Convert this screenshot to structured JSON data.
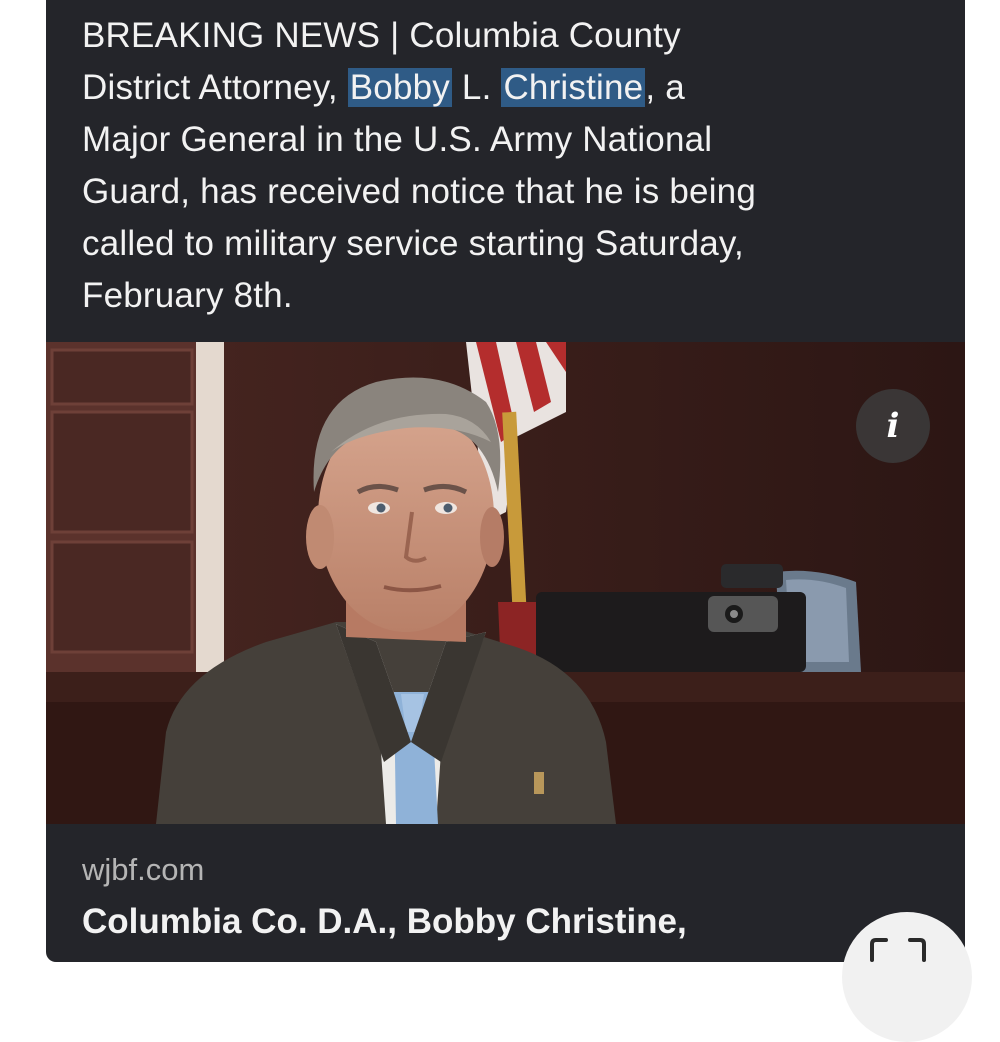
{
  "post": {
    "line1": "BREAKING NEWS | Columbia County",
    "line2_prefix": "District Attorney, ",
    "line2_highlight1": "Bobby",
    "line2_mid": " L. ",
    "line2_highlight2": "Christine",
    "line2_suffix": ", a",
    "line3": "Major General in the U.S. Army National",
    "line4": "Guard, has received notice that he is being",
    "line5": "called to military service starting Saturday,",
    "line6": "February 8th."
  },
  "link_preview": {
    "source": "wjbf.com",
    "headline": "Columbia Co. D.A., Bobby Christine,"
  },
  "colors": {
    "card_background": "#24252a",
    "text_highlight": "#2f5b86"
  },
  "icons": {
    "info": "info-icon",
    "screenshot": "screenshot-icon"
  }
}
